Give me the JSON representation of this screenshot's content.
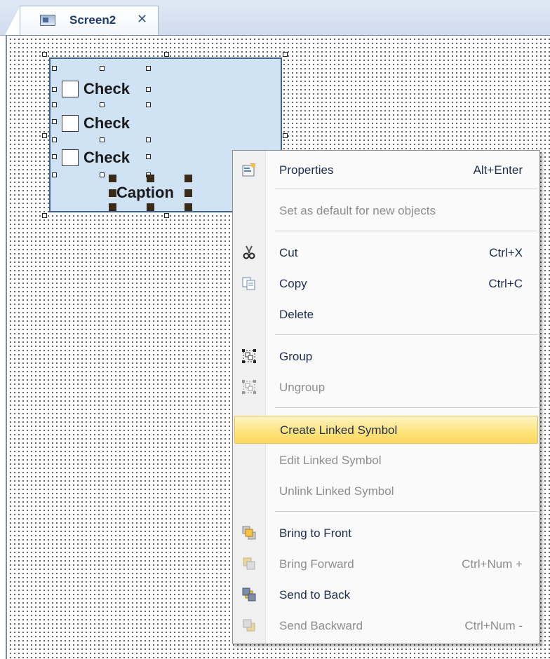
{
  "tab": {
    "label": "Screen2",
    "close": "✕"
  },
  "canvas": {
    "checkboxes": [
      "Check",
      "Check",
      "Check"
    ],
    "caption": "Caption"
  },
  "context_menu": {
    "items": [
      {
        "label": "Properties",
        "shortcut": "Alt+Enter",
        "enabled": true,
        "icon": "properties-icon"
      },
      {
        "label": "Set as default for new objects",
        "shortcut": "",
        "enabled": false
      },
      {
        "label": "Cut",
        "shortcut": "Ctrl+X",
        "enabled": true,
        "icon": "scissors-icon"
      },
      {
        "label": "Copy",
        "shortcut": "Ctrl+C",
        "enabled": true,
        "icon": "copy-icon"
      },
      {
        "label": "Delete",
        "shortcut": "",
        "enabled": true
      },
      {
        "label": "Group",
        "shortcut": "",
        "enabled": true,
        "icon": "group-icon"
      },
      {
        "label": "Ungroup",
        "shortcut": "",
        "enabled": false,
        "icon": "ungroup-icon"
      },
      {
        "label": "Create Linked Symbol",
        "shortcut": "",
        "enabled": true,
        "highlighted": true
      },
      {
        "label": "Edit Linked Symbol",
        "shortcut": "",
        "enabled": false
      },
      {
        "label": "Unlink Linked Symbol",
        "shortcut": "",
        "enabled": false
      },
      {
        "label": "Bring to Front",
        "shortcut": "",
        "enabled": true,
        "icon": "bring-to-front-icon"
      },
      {
        "label": "Bring Forward",
        "shortcut": "Ctrl+Num +",
        "enabled": false,
        "icon": "bring-forward-icon"
      },
      {
        "label": "Send to Back",
        "shortcut": "",
        "enabled": true,
        "icon": "send-to-back-icon"
      },
      {
        "label": "Send Backward",
        "shortcut": "Ctrl+Num -",
        "enabled": false,
        "icon": "send-backward-icon"
      }
    ]
  },
  "colors": {
    "highlight": "#fde37a",
    "selection_fill": "#cfe3f5",
    "selection_border": "#3d6394"
  }
}
